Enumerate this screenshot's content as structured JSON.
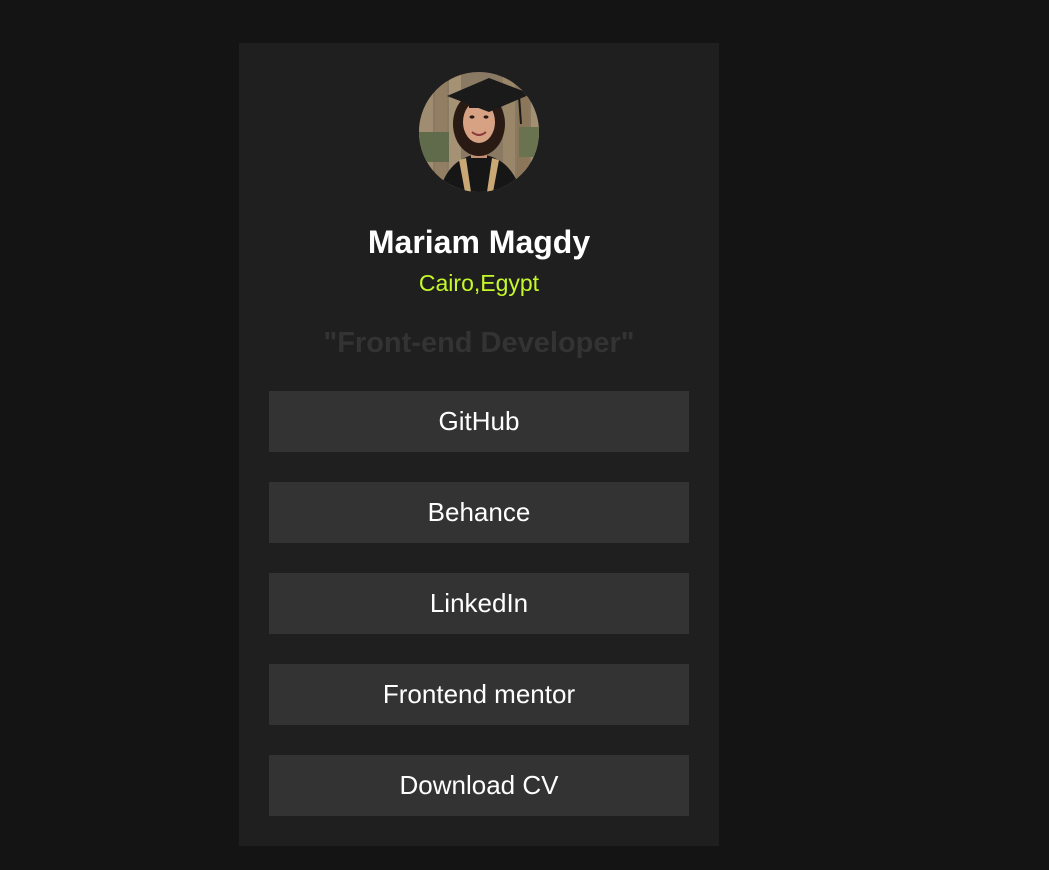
{
  "profile": {
    "name": "Mariam Magdy",
    "location": "Cairo,Egypt",
    "tagline": "\"Front-end Developer\""
  },
  "links": [
    {
      "label": "GitHub"
    },
    {
      "label": "Behance"
    },
    {
      "label": "LinkedIn"
    },
    {
      "label": "Frontend mentor"
    },
    {
      "label": "Download CV"
    }
  ],
  "colors": {
    "page_background": "#141414",
    "card_background": "#1f1f1f",
    "button_background": "#333333",
    "accent": "#c4f82a",
    "text": "#ffffff"
  }
}
